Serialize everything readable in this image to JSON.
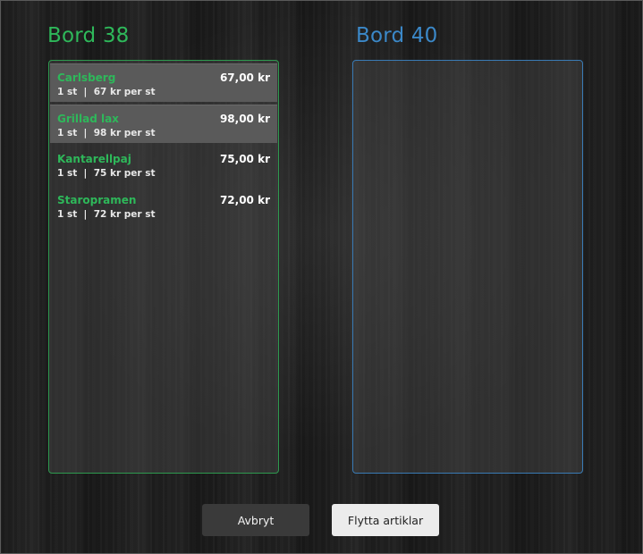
{
  "source_table": {
    "title": "Bord 38",
    "items": [
      {
        "name": "Carlsberg",
        "price": "67,00 kr",
        "detail": "1 st  |  67 kr per st",
        "selected": true
      },
      {
        "name": "Grillad lax",
        "price": "98,00 kr",
        "detail": "1 st  |  98 kr per st",
        "selected": true
      },
      {
        "name": "Kantarellpaj",
        "price": "75,00 kr",
        "detail": "1 st  |  75 kr per st",
        "selected": false
      },
      {
        "name": "Staropramen",
        "price": "72,00 kr",
        "detail": "1 st  |  72 kr per st",
        "selected": false
      }
    ]
  },
  "target_table": {
    "title": "Bord 40",
    "items": []
  },
  "buttons": {
    "cancel_label": "Avbryt",
    "move_label": "Flytta artiklar"
  },
  "colors": {
    "source_accent": "#2eb85a",
    "target_accent": "#3b88c8"
  }
}
